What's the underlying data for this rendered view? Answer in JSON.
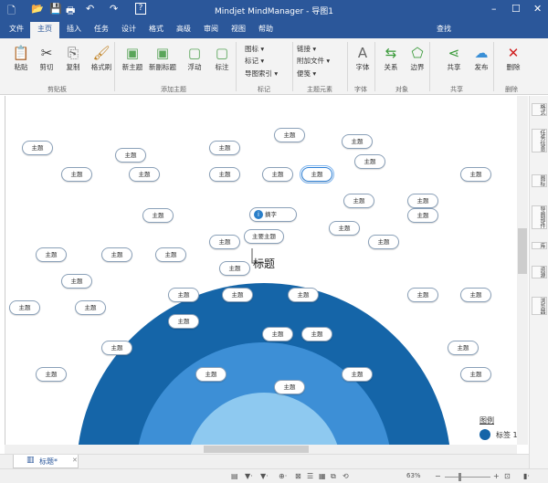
{
  "window": {
    "title": "Mindjet MindManager - 导图1",
    "minimize": "–",
    "maximize": "☐",
    "close": "✕"
  },
  "quick_access": {
    "new": "🗋",
    "open": "📂",
    "save": "💾",
    "print": "🖶",
    "undo": "↶",
    "redo": "↷",
    "help": "?"
  },
  "menu_tabs": [
    "文件",
    "主页",
    "插入",
    "任务",
    "设计",
    "格式",
    "高级",
    "审阅",
    "视图",
    "帮助"
  ],
  "search_label": "查找",
  "ribbon": {
    "buttons": [
      {
        "label": "粘贴",
        "icon": "📋"
      },
      {
        "label": "剪切",
        "icon": "✂"
      },
      {
        "label": "复制",
        "icon": "⎘"
      },
      {
        "label": "格式刷",
        "icon": "🖌"
      },
      {
        "label": "新主题",
        "icon": "▣"
      },
      {
        "label": "新副标题",
        "icon": "▣"
      },
      {
        "label": "浮动",
        "icon": "▢"
      },
      {
        "label": "标注",
        "icon": "▢"
      },
      {
        "label": "字体",
        "icon": "A"
      },
      {
        "label": "关系",
        "icon": "⇆"
      },
      {
        "label": "边界",
        "icon": "⬠"
      },
      {
        "label": "共享",
        "icon": "⋖"
      },
      {
        "label": "发布",
        "icon": "☁"
      },
      {
        "label": "删除",
        "icon": "✕"
      }
    ],
    "small": [
      {
        "label": "图标 ▾"
      },
      {
        "label": "标记 ▾"
      },
      {
        "label": "导图索引 ▾"
      },
      {
        "label": "链接 ▾"
      },
      {
        "label": "附加文件 ▾"
      },
      {
        "label": "便笺 ▾"
      }
    ],
    "groups": [
      "剪贴板",
      "添加主题",
      "标记",
      "主题元素",
      "字体",
      "对象",
      "共享",
      "删除"
    ]
  },
  "canvas": {
    "topic_label": "主题",
    "callout": "摘字",
    "main_subtopic": "主要主题",
    "central_title": "标题",
    "legend_title": "图例",
    "legend_item": "标签 1",
    "colors": {
      "outer": "#1565a8",
      "middle": "#3d8fd6",
      "inner": "#8ec9f0",
      "topic_border": "#8aa0b8"
    }
  },
  "side_panel": [
    "格式",
    "任务信息",
    "图标",
    "导图部件",
    "库",
    "资源",
    "浏览器"
  ],
  "doc_tab": {
    "label": "标题*"
  },
  "status": {
    "zoom": "63%"
  }
}
